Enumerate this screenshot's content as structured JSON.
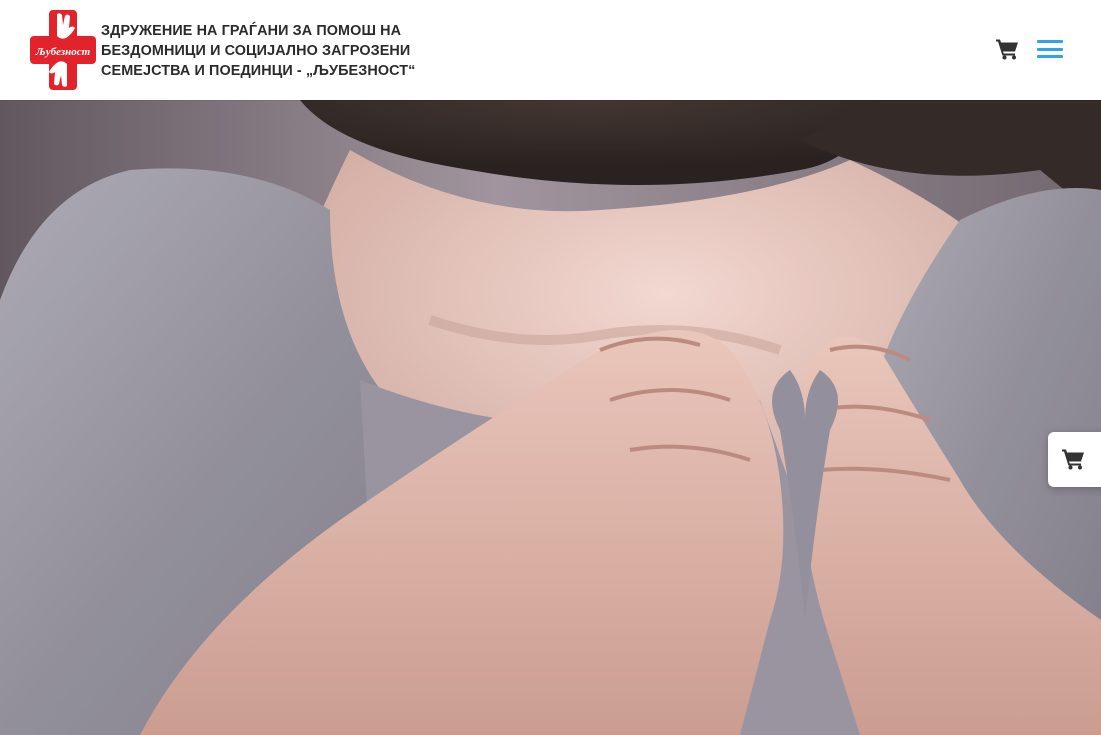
{
  "header": {
    "logo": {
      "badge_text": "Љубезност",
      "lines": [
        "ЗДРУЖЕНИЕ НА ГРАЃАНИ ЗА ПОМОШ НА",
        "БЕЗДОМНИЦИ И СОЦИЈАЛНО ЗАГРОЗЕНИ",
        "СЕМЕЈСТВА И ПОЕДИНЦИ - „ЉУБЕЗНОСТ“"
      ]
    },
    "icons": {
      "cart": "shopping-cart-icon",
      "menu": "hamburger-menu-icon"
    }
  },
  "hero": {
    "image": "hands-heart-gesture-photo"
  },
  "floating_cart": {
    "icon": "shopping-cart-icon"
  },
  "colors": {
    "brand_red": "#e3232b",
    "accent_blue": "#2ea3f2",
    "header_text": "#2b2b2b",
    "icon_dark": "#333333"
  }
}
